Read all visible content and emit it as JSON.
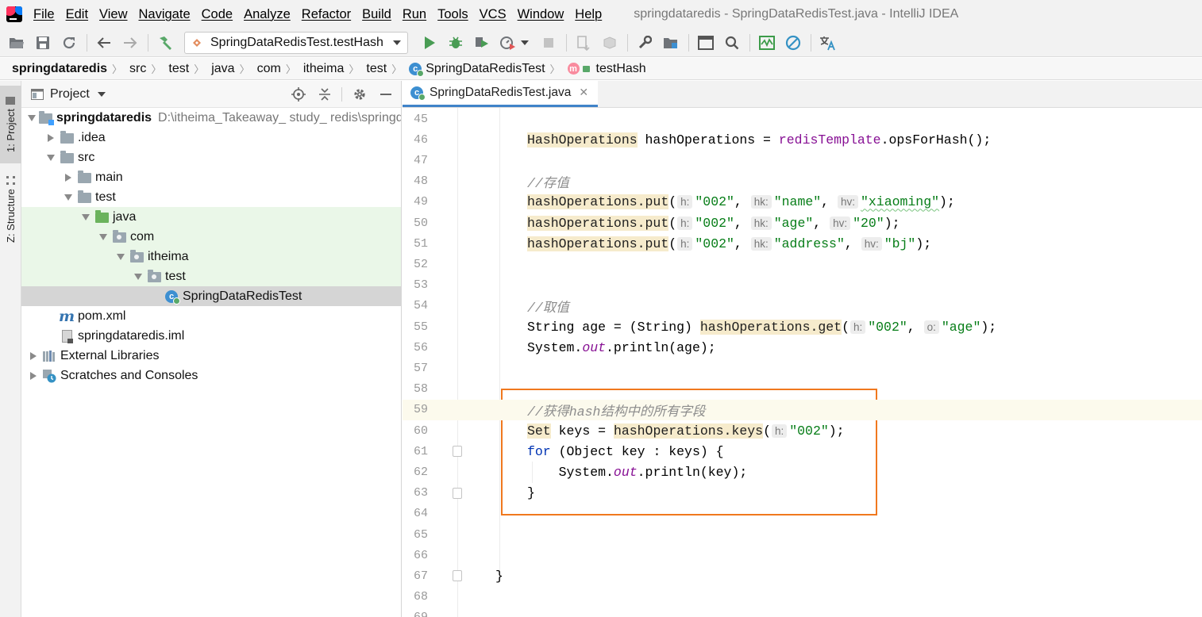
{
  "menubar": {
    "items": [
      "File",
      "Edit",
      "View",
      "Navigate",
      "Code",
      "Analyze",
      "Refactor",
      "Build",
      "Run",
      "Tools",
      "VCS",
      "Window",
      "Help"
    ],
    "window_title": "springdataredis - SpringDataRedisTest.java - IntelliJ IDEA"
  },
  "toolbar": {
    "run_config": "SpringDataRedisTest.testHash",
    "icons": [
      "open-folder-icon",
      "save-icon",
      "sync-icon",
      "back-icon",
      "forward-icon",
      "build-hammer-icon",
      "run-icon",
      "debug-icon",
      "coverage-icon",
      "profile-icon",
      "stop-icon",
      "vcs-update-icon",
      "vcs-commit-icon",
      "settings-wrench-icon",
      "project-structure-icon",
      "terminal-icon",
      "search-icon",
      "monitor-icon",
      "no-icon",
      "translate-icon"
    ]
  },
  "breadcrumb": [
    "springdataredis",
    "src",
    "test",
    "java",
    "com",
    "itheima",
    "test",
    "SpringDataRedisTest",
    "testHash"
  ],
  "left_strip": {
    "project_tab": "1: Project",
    "structure_tab": "Z: Structure"
  },
  "project_panel": {
    "title": "Project",
    "tree": [
      {
        "label": "springdataredis",
        "path": "D:\\itheima_Takeaway_ study_ redis\\springdataredis",
        "icon": "module-folder-icon",
        "depth": 0,
        "expanded": true
      },
      {
        "label": ".idea",
        "icon": "folder-icon",
        "depth": 1,
        "expanded": false
      },
      {
        "label": "src",
        "icon": "folder-icon",
        "depth": 1,
        "expanded": true
      },
      {
        "label": "main",
        "icon": "folder-icon",
        "depth": 2,
        "expanded": false
      },
      {
        "label": "test",
        "icon": "folder-icon",
        "depth": 2,
        "expanded": true
      },
      {
        "label": "java",
        "icon": "test-source-folder-icon",
        "depth": 3,
        "expanded": true
      },
      {
        "label": "com",
        "icon": "package-icon",
        "depth": 4,
        "expanded": true
      },
      {
        "label": "itheima",
        "icon": "package-icon",
        "depth": 5,
        "expanded": true
      },
      {
        "label": "test",
        "icon": "package-icon",
        "depth": 6,
        "expanded": true
      },
      {
        "label": "SpringDataRedisTest",
        "icon": "test-class-icon",
        "depth": 7
      },
      {
        "label": "pom.xml",
        "icon": "maven-icon",
        "depth": 1
      },
      {
        "label": "springdataredis.iml",
        "icon": "iml-file-icon",
        "depth": 1
      },
      {
        "label": "External Libraries",
        "icon": "libraries-icon",
        "depth": 0,
        "expanded": false
      },
      {
        "label": "Scratches and Consoles",
        "icon": "scratches-icon",
        "depth": 0,
        "expanded": false
      }
    ]
  },
  "editor": {
    "tab_label": "SpringDataRedisTest.java",
    "lines": [
      {
        "n": "45",
        "tokens": []
      },
      {
        "n": "46",
        "tokens": [
          [
            "hl",
            "HashOperations"
          ],
          [
            "t",
            " hashOperations = "
          ],
          [
            "field",
            "redisTemplate"
          ],
          [
            "t",
            ".opsForHash();"
          ]
        ]
      },
      {
        "n": "47",
        "tokens": []
      },
      {
        "n": "48",
        "tokens": [
          [
            "cmt",
            "//存值"
          ]
        ]
      },
      {
        "n": "49",
        "tokens": [
          [
            "hl",
            "hashOperations.put"
          ],
          [
            "t",
            "("
          ],
          [
            "hint",
            "h:"
          ],
          [
            "str",
            "\"002\""
          ],
          [
            "t",
            ", "
          ],
          [
            "hint",
            "hk:"
          ],
          [
            "str",
            "\"name\""
          ],
          [
            "t",
            ", "
          ],
          [
            "hint",
            "hv:"
          ],
          [
            "strw",
            "\"xiaoming\""
          ],
          [
            "t",
            ");"
          ]
        ]
      },
      {
        "n": "50",
        "tokens": [
          [
            "hl",
            "hashOperations.put"
          ],
          [
            "t",
            "("
          ],
          [
            "hint",
            "h:"
          ],
          [
            "str",
            "\"002\""
          ],
          [
            "t",
            ", "
          ],
          [
            "hint",
            "hk:"
          ],
          [
            "str",
            "\"age\""
          ],
          [
            "t",
            ", "
          ],
          [
            "hint",
            "hv:"
          ],
          [
            "str",
            "\"20\""
          ],
          [
            "t",
            ");"
          ]
        ]
      },
      {
        "n": "51",
        "tokens": [
          [
            "hl",
            "hashOperations.put"
          ],
          [
            "t",
            "("
          ],
          [
            "hint",
            "h:"
          ],
          [
            "str",
            "\"002\""
          ],
          [
            "t",
            ", "
          ],
          [
            "hint",
            "hk:"
          ],
          [
            "str",
            "\"address\""
          ],
          [
            "t",
            ", "
          ],
          [
            "hint",
            "hv:"
          ],
          [
            "str",
            "\"bj\""
          ],
          [
            "t",
            ");"
          ]
        ]
      },
      {
        "n": "52",
        "tokens": []
      },
      {
        "n": "53",
        "tokens": []
      },
      {
        "n": "54",
        "tokens": [
          [
            "cmt",
            "//取值"
          ]
        ]
      },
      {
        "n": "55",
        "tokens": [
          [
            "t",
            "String age = (String) "
          ],
          [
            "hl",
            "hashOperations.get"
          ],
          [
            "t",
            "("
          ],
          [
            "hint",
            "h:"
          ],
          [
            "str",
            "\"002\""
          ],
          [
            "t",
            ", "
          ],
          [
            "hint",
            "o:"
          ],
          [
            "str",
            "\"age\""
          ],
          [
            "t",
            ");"
          ]
        ]
      },
      {
        "n": "56",
        "tokens": [
          [
            "t",
            "System."
          ],
          [
            "static",
            "out"
          ],
          [
            "t",
            ".println(age);"
          ]
        ]
      },
      {
        "n": "57",
        "tokens": []
      },
      {
        "n": "58",
        "tokens": []
      },
      {
        "n": "59",
        "tokens": [
          [
            "cmt",
            "//获得hash结构中的所有字段"
          ]
        ],
        "current": true
      },
      {
        "n": "60",
        "tokens": [
          [
            "hl",
            "Set"
          ],
          [
            "t",
            " keys = "
          ],
          [
            "hl",
            "hashOperations.keys"
          ],
          [
            "t",
            "("
          ],
          [
            "hint",
            "h:"
          ],
          [
            "str",
            "\"002\""
          ],
          [
            "t",
            ");"
          ]
        ]
      },
      {
        "n": "61",
        "tokens": [
          [
            "kw",
            "for"
          ],
          [
            "t",
            " (Object key : keys) {"
          ]
        ]
      },
      {
        "n": "62",
        "tokens": [
          [
            "t",
            "    System."
          ],
          [
            "static",
            "out"
          ],
          [
            "t",
            ".println(key);"
          ]
        ]
      },
      {
        "n": "63",
        "tokens": [
          [
            "t",
            "}"
          ]
        ]
      },
      {
        "n": "64",
        "tokens": []
      },
      {
        "n": "65",
        "tokens": []
      },
      {
        "n": "66",
        "tokens": []
      },
      {
        "n": "67",
        "tokens": [
          [
            "t",
            "}"
          ]
        ],
        "outer": true
      },
      {
        "n": "68",
        "tokens": []
      },
      {
        "n": "69",
        "tokens": []
      }
    ]
  },
  "colors": {
    "highlight_box": "#f0781e",
    "string": "#067d17",
    "keyword": "#0033b3",
    "field": "#871094",
    "comment": "#8c8c8c",
    "usage_highlight": "#f6ebcc",
    "test_source_background": "#eaf7e8"
  }
}
